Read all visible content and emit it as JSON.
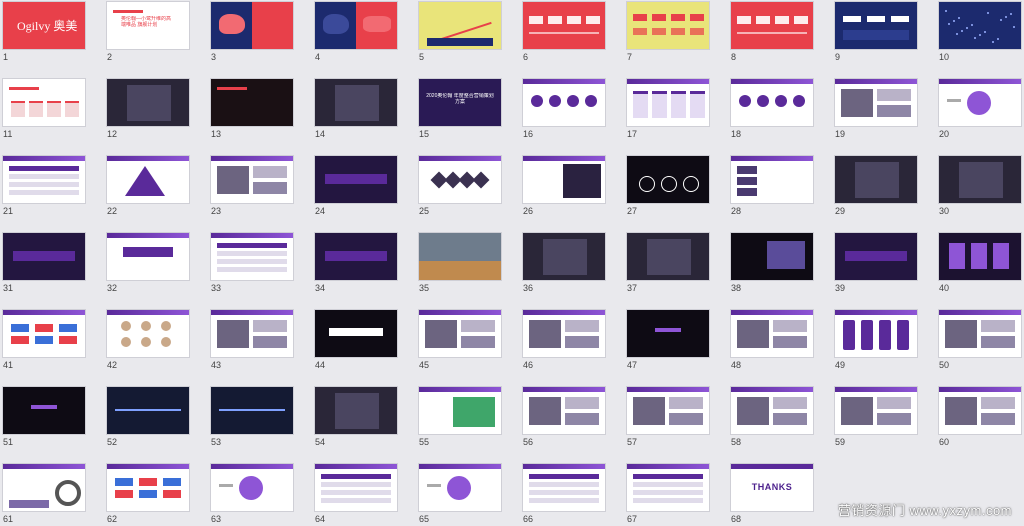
{
  "slides": [
    {
      "n": "1",
      "style": "red-logo",
      "brand": "Ogilvy 奥美"
    },
    {
      "n": "2",
      "style": "white-red",
      "title": "奥伦翰—小鹭升维的高端唯品 旗舰计划"
    },
    {
      "n": "3",
      "style": "map-red"
    },
    {
      "n": "4",
      "style": "map-blue"
    },
    {
      "n": "5",
      "style": "yellow-chart"
    },
    {
      "n": "6",
      "style": "red-stats"
    },
    {
      "n": "7",
      "style": "yellow-stats"
    },
    {
      "n": "8",
      "style": "red-bars"
    },
    {
      "n": "9",
      "style": "navy-stats"
    },
    {
      "n": "10",
      "style": "navy-dots"
    },
    {
      "n": "11",
      "style": "white-red"
    },
    {
      "n": "12",
      "style": "dark-photo"
    },
    {
      "n": "13",
      "style": "dark-red"
    },
    {
      "n": "14",
      "style": "dark-photo"
    },
    {
      "n": "15",
      "style": "purple-title",
      "title": "2020奥伦翰 年度整合营销策划方案"
    },
    {
      "n": "16",
      "style": "white-circles"
    },
    {
      "n": "17",
      "style": "white-cards"
    },
    {
      "n": "18",
      "style": "white-circles"
    },
    {
      "n": "19",
      "style": "white-photos"
    },
    {
      "n": "20",
      "style": "white-diagram"
    },
    {
      "n": "21",
      "style": "white-table"
    },
    {
      "n": "22",
      "style": "white-pyramid"
    },
    {
      "n": "23",
      "style": "white-photos"
    },
    {
      "n": "24",
      "style": "dark-purple"
    },
    {
      "n": "25",
      "style": "white-hex"
    },
    {
      "n": "26",
      "style": "white-dark"
    },
    {
      "n": "27",
      "style": "black-circles"
    },
    {
      "n": "28",
      "style": "white-list"
    },
    {
      "n": "29",
      "style": "dark-photo"
    },
    {
      "n": "30",
      "style": "dark-photo"
    },
    {
      "n": "31",
      "style": "dark-purple"
    },
    {
      "n": "32",
      "style": "white-quote"
    },
    {
      "n": "33",
      "style": "white-table"
    },
    {
      "n": "34",
      "style": "dark-purple"
    },
    {
      "n": "35",
      "style": "landscape"
    },
    {
      "n": "36",
      "style": "dark-photo"
    },
    {
      "n": "37",
      "style": "dark-photo"
    },
    {
      "n": "38",
      "style": "black-tv"
    },
    {
      "n": "39",
      "style": "dark-purple"
    },
    {
      "n": "40",
      "style": "dark-cards"
    },
    {
      "n": "41",
      "style": "white-logos"
    },
    {
      "n": "42",
      "style": "white-people"
    },
    {
      "n": "43",
      "style": "white-photos"
    },
    {
      "n": "44",
      "style": "black-banner"
    },
    {
      "n": "45",
      "style": "white-photos"
    },
    {
      "n": "46",
      "style": "white-photos"
    },
    {
      "n": "47",
      "style": "black-text"
    },
    {
      "n": "48",
      "style": "white-photos"
    },
    {
      "n": "49",
      "style": "white-phones"
    },
    {
      "n": "50",
      "style": "white-photos"
    },
    {
      "n": "51",
      "style": "black-text"
    },
    {
      "n": "52",
      "style": "dark-blue"
    },
    {
      "n": "53",
      "style": "dark-blue"
    },
    {
      "n": "54",
      "style": "dark-photo"
    },
    {
      "n": "55",
      "style": "white-green"
    },
    {
      "n": "56",
      "style": "white-photos"
    },
    {
      "n": "57",
      "style": "white-photos"
    },
    {
      "n": "58",
      "style": "white-photos"
    },
    {
      "n": "59",
      "style": "white-photos"
    },
    {
      "n": "60",
      "style": "white-photos"
    },
    {
      "n": "61",
      "style": "white-chart"
    },
    {
      "n": "62",
      "style": "white-logos"
    },
    {
      "n": "63",
      "style": "white-diagram"
    },
    {
      "n": "64",
      "style": "white-table"
    },
    {
      "n": "65",
      "style": "white-diagram"
    },
    {
      "n": "66",
      "style": "white-table"
    },
    {
      "n": "67",
      "style": "white-table"
    },
    {
      "n": "68",
      "style": "thanks",
      "brand": "THANKS"
    }
  ],
  "watermark": "营销资源门 www.yxzym.com",
  "colors": {
    "red": "#e8404a",
    "purple": "#5a2a9a",
    "purple_light": "#8e55d6",
    "navy": "#1c2a6e",
    "yellow": "#e9e47a",
    "dark": "#1a1530",
    "bg": "#e9e9ed"
  }
}
